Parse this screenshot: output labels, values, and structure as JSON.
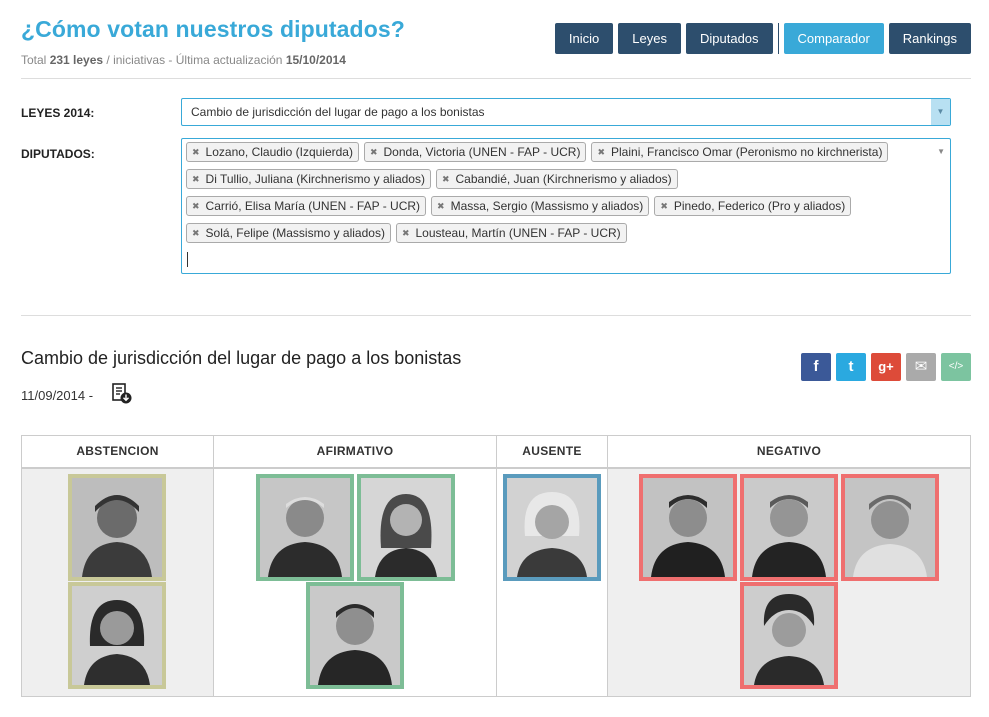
{
  "header": {
    "title": "¿Cómo votan nuestros diputados?",
    "subtitle": {
      "prefix": "Total ",
      "count": "231 leyes",
      "middle": " / iniciativas - Última actualización ",
      "date": "15/10/2014"
    }
  },
  "nav": {
    "inicio": "Inicio",
    "leyes": "Leyes",
    "diputados": "Diputados",
    "comparador": "Comparador",
    "rankings": "Rankings"
  },
  "form": {
    "leyes_label": "LEYES 2014:",
    "diputados_label": "DIPUTADOS:",
    "selected_law": "Cambio de jurisdicción del lugar de pago a los bonistas",
    "chips": [
      "Lozano, Claudio (Izquierda)",
      "Donda, Victoria (UNEN - FAP - UCR)",
      "Plaini, Francisco Omar (Peronismo no kirchnerista)",
      "Di Tullio, Juliana (Kirchnerismo y aliados)",
      "Cabandié, Juan (Kirchnerismo y aliados)",
      "Carrió, Elisa María (UNEN - FAP - UCR)",
      "Massa, Sergio (Massismo y aliados)",
      "Pinedo, Federico (Pro y aliados)",
      "Solá, Felipe (Massismo y aliados)",
      "Lousteau, Martín (UNEN - FAP - UCR)"
    ]
  },
  "law": {
    "title": "Cambio de jurisdicción del lugar de pago a los bonistas",
    "date": "11/09/2014 -"
  },
  "share": {
    "facebook": "f",
    "twitter": "t",
    "gplus": "g+",
    "email": "✉",
    "embed": "</>",
    "colors": {
      "facebook": "#3b5998",
      "twitter": "#2aa9e0",
      "gplus": "#dd4b39",
      "email": "#aaaaaa",
      "embed": "#7cc4a0"
    }
  },
  "votes": {
    "headers": {
      "abstencion": "ABSTENCION",
      "afirmativo": "AFIRMATIVO",
      "ausente": "AUSENTE",
      "negativo": "NEGATIVO"
    },
    "colors": {
      "abstencion": "#c8c898",
      "afirmativo": "#7dbd96",
      "ausente": "#5a9bbd",
      "negativo": "#ef6f6f"
    }
  }
}
